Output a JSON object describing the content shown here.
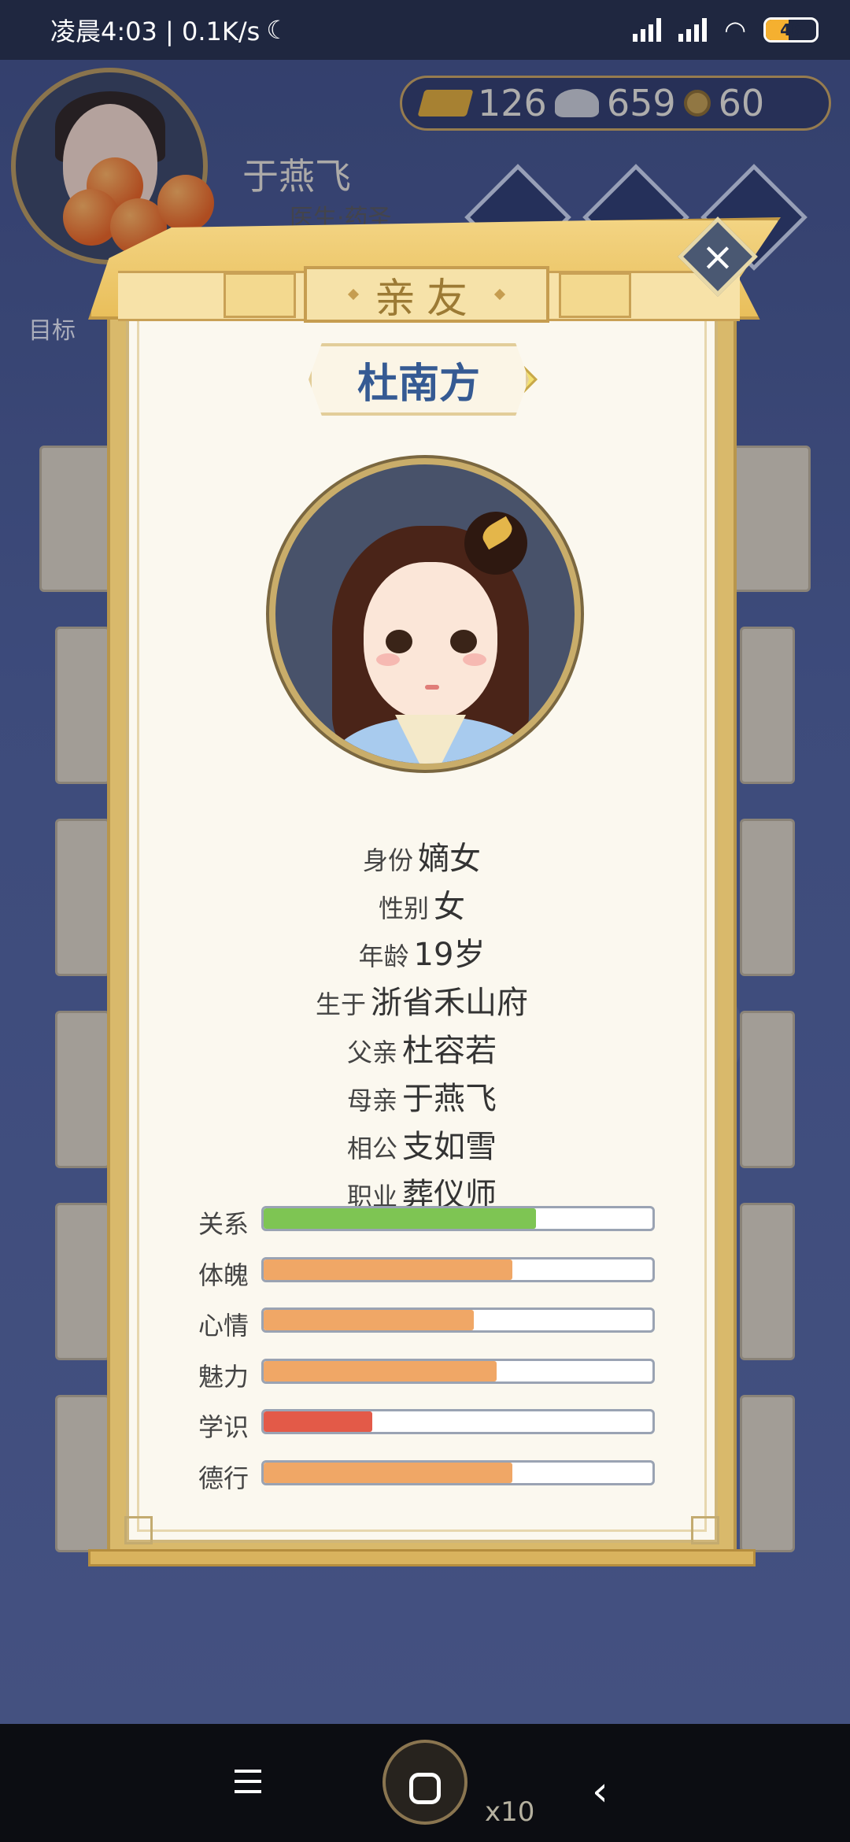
{
  "status_bar": {
    "time_speed": "凌晨4:03 | 0.1K/s",
    "moon_icon": "moon-icon",
    "battery": "46",
    "battery_level": 0.46
  },
  "hud": {
    "player_name": "于燕飞",
    "player_title": "医生·药圣",
    "currency": {
      "gold": "126",
      "silver": "659",
      "coin": "60"
    },
    "goal_label": "目标"
  },
  "dialog": {
    "title": "亲友",
    "name": "杜南方",
    "info": [
      {
        "label": "身份",
        "value": "嫡女"
      },
      {
        "label": "性别",
        "value": "女"
      },
      {
        "label": "年龄",
        "value": "19岁"
      },
      {
        "label": "生于",
        "value": "浙省禾山府"
      },
      {
        "label": "父亲",
        "value": "杜容若"
      },
      {
        "label": "母亲",
        "value": "于燕飞"
      },
      {
        "label": "相公",
        "value": "支如雪"
      },
      {
        "label": "职业",
        "value": "葬仪师"
      }
    ],
    "stats": [
      {
        "label": "关系",
        "value": 0.7,
        "color": "#7ec553"
      },
      {
        "label": "体魄",
        "value": 0.64,
        "color": "#f0a766"
      },
      {
        "label": "心情",
        "value": 0.54,
        "color": "#f0a766"
      },
      {
        "label": "魅力",
        "value": 0.6,
        "color": "#f0a766"
      },
      {
        "label": "学识",
        "value": 0.28,
        "color": "#e35a48"
      },
      {
        "label": "德行",
        "value": 0.64,
        "color": "#f0a766"
      }
    ]
  },
  "nav": {
    "float_count": "x10"
  }
}
